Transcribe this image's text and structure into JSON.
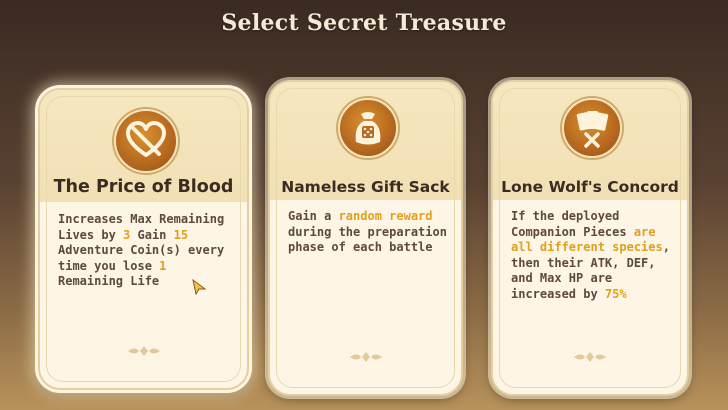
{
  "header": {
    "title": "Select Secret Treasure"
  },
  "cards": [
    {
      "name": "The Price of Blood",
      "icon": "heart-crossed-icon",
      "selected": true,
      "desc": [
        {
          "t": "Increases Max Remaining Lives by "
        },
        {
          "t": "3",
          "hl": true
        },
        {
          "t": " Gain "
        },
        {
          "t": "15",
          "hl": true
        },
        {
          "t": " Adventure Coin(s) every time you lose "
        },
        {
          "t": "1",
          "hl": true
        },
        {
          "t": " Remaining Life"
        }
      ]
    },
    {
      "name": "Nameless Gift Sack",
      "icon": "gift-sack-dice-icon",
      "selected": false,
      "desc": [
        {
          "t": "Gain a "
        },
        {
          "t": "random reward",
          "hl": true
        },
        {
          "t": " during the preparation phase of each battle"
        }
      ]
    },
    {
      "name": "Lone Wolf's Concord",
      "icon": "cards-cross-icon",
      "selected": false,
      "desc": [
        {
          "t": "If the deployed Companion Pieces "
        },
        {
          "t": "are all different species",
          "hl": true
        },
        {
          "t": ", then their ATK, DEF, and Max HP are increased by "
        },
        {
          "t": "75%",
          "hl": true
        }
      ]
    }
  ],
  "colors": {
    "highlight": "#e39e1c",
    "text": "#5d4a3c",
    "title": "#3b2c22"
  }
}
